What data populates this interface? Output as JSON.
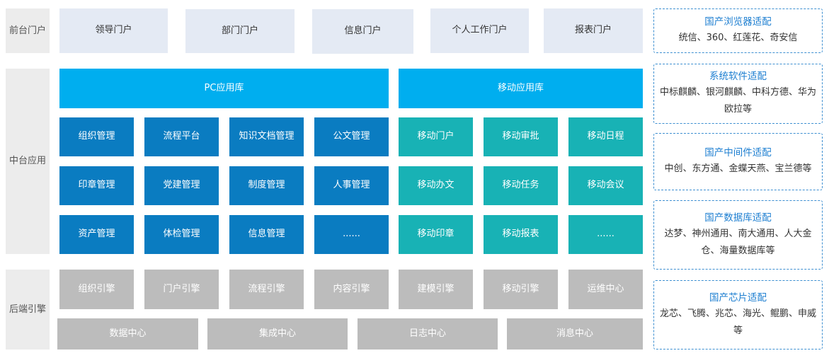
{
  "layers": {
    "front": "前台门户",
    "middle": "中台应用",
    "back": "后端引擎"
  },
  "portals": [
    "领导门户",
    "部门门户",
    "信息门户",
    "个人工作门户",
    "报表门户"
  ],
  "libraries": {
    "pc": "PC应用库",
    "mobile": "移动应用库"
  },
  "pc_apps": [
    [
      "组织管理",
      "流程平台",
      "知识文档管理",
      "公文管理"
    ],
    [
      "印章管理",
      "党建管理",
      "制度管理",
      "人事管理"
    ],
    [
      "资产管理",
      "体检管理",
      "信息管理",
      "......"
    ]
  ],
  "mobile_apps": [
    [
      "移动门户",
      "移动审批",
      "移动日程"
    ],
    [
      "移动办文",
      "移动任务",
      "移动会议"
    ],
    [
      "移动印章",
      "移动报表",
      "......"
    ]
  ],
  "engines": [
    "组织引擎",
    "门户引擎",
    "流程引擎",
    "内容引擎",
    "建模引擎",
    "移动引擎",
    "运维中心"
  ],
  "centers": [
    "数据中心",
    "集成中心",
    "日志中心",
    "消息中心"
  ],
  "adaptations": [
    {
      "title": "国产浏览器适配",
      "desc": "统信、360、红莲花、奇安信"
    },
    {
      "title": "系统软件适配",
      "desc": "中标麒麟、银河麒麟、中科方德、华为欧拉等"
    },
    {
      "title": "国产中间件适配",
      "desc": "中创、东方通、金蝶天燕、宝兰德等"
    },
    {
      "title": "国产数据库适配",
      "desc": "达梦、神州通用、南大通用、人大金仓、海量数据库等"
    },
    {
      "title": "国产芯片适配",
      "desc": "龙芯、飞腾、兆芯、海光、鲲鹏、申威等"
    }
  ],
  "colors": {
    "portal": "#e4eaf4",
    "library": "#00aeef",
    "pc_app": "#0a7cc1",
    "mobile_app": "#18b2b5",
    "engine": "#bcbcbc",
    "layer": "#ececec",
    "adapt_border": "#3d8fd1",
    "adapt_title": "#1e7fd1"
  }
}
